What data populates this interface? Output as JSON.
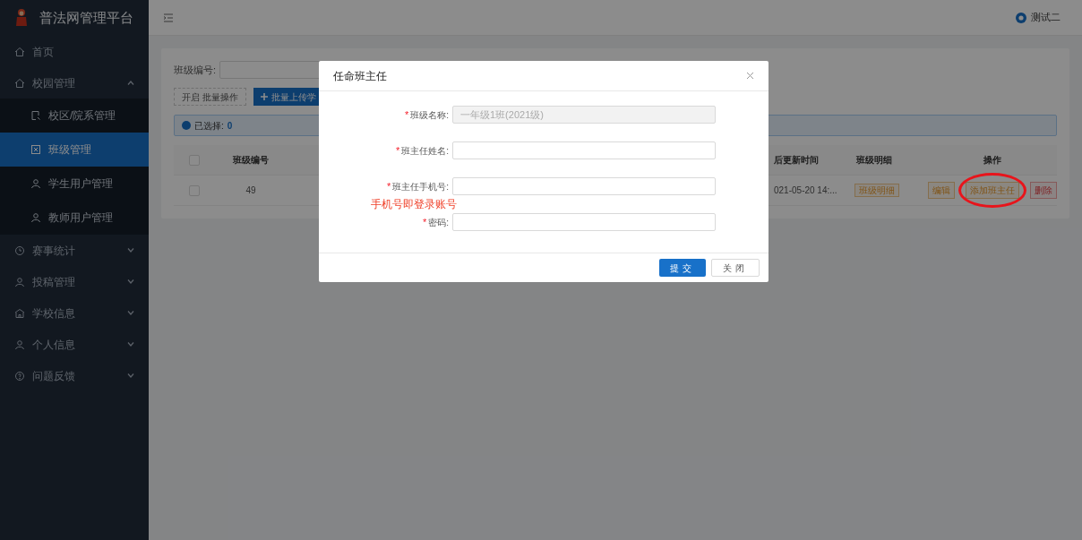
{
  "app": {
    "title": "普法网管理平台"
  },
  "header": {
    "user": "测试二"
  },
  "sidebar": {
    "items": [
      {
        "label": "首页"
      },
      {
        "label": "校园管理",
        "expanded": true,
        "children": [
          {
            "label": "校区/院系管理",
            "selected": false
          },
          {
            "label": "班级管理",
            "selected": true
          },
          {
            "label": "学生用户管理",
            "selected": false
          },
          {
            "label": "教师用户管理",
            "selected": false
          }
        ]
      },
      {
        "label": "赛事统计",
        "expanded": false
      },
      {
        "label": "投稿管理",
        "expanded": false
      },
      {
        "label": "学校信息",
        "expanded": false
      },
      {
        "label": "个人信息",
        "expanded": false
      },
      {
        "label": "问题反馈",
        "expanded": false
      }
    ]
  },
  "filter": {
    "label": "班级编号:"
  },
  "toolbar": {
    "batch_button": "开启 批量操作",
    "upload_button": "批量上传学"
  },
  "alert": {
    "label": "已选择:",
    "count": "0"
  },
  "table": {
    "header_checked": false,
    "columns": [
      "班级编号",
      "后更新时间",
      "班级明细",
      "操作"
    ],
    "rows": [
      {
        "checked": false,
        "id": "49",
        "updated": "021-05-20 14:...",
        "detail": "班级明细",
        "actions": [
          {
            "label": "编辑",
            "kind": "warning",
            "circled": false
          },
          {
            "label": "添加班主任",
            "kind": "warning",
            "circled": true
          },
          {
            "label": "删除",
            "kind": "danger",
            "circled": false
          }
        ]
      }
    ]
  },
  "modal": {
    "title": "任命班主任",
    "required_mark": "*",
    "fields": [
      {
        "label": "班级名称:",
        "required": true,
        "value": "一年级1班(2021级)",
        "disabled": true
      },
      {
        "label": "班主任姓名:",
        "required": true,
        "disabled": false
      },
      {
        "label": "班主任手机号:",
        "required": true,
        "disabled": false,
        "note": "手机号即登录账号"
      },
      {
        "label": "密码:",
        "required": true,
        "disabled": false
      }
    ],
    "submit": "提交",
    "close": "关闭"
  }
}
